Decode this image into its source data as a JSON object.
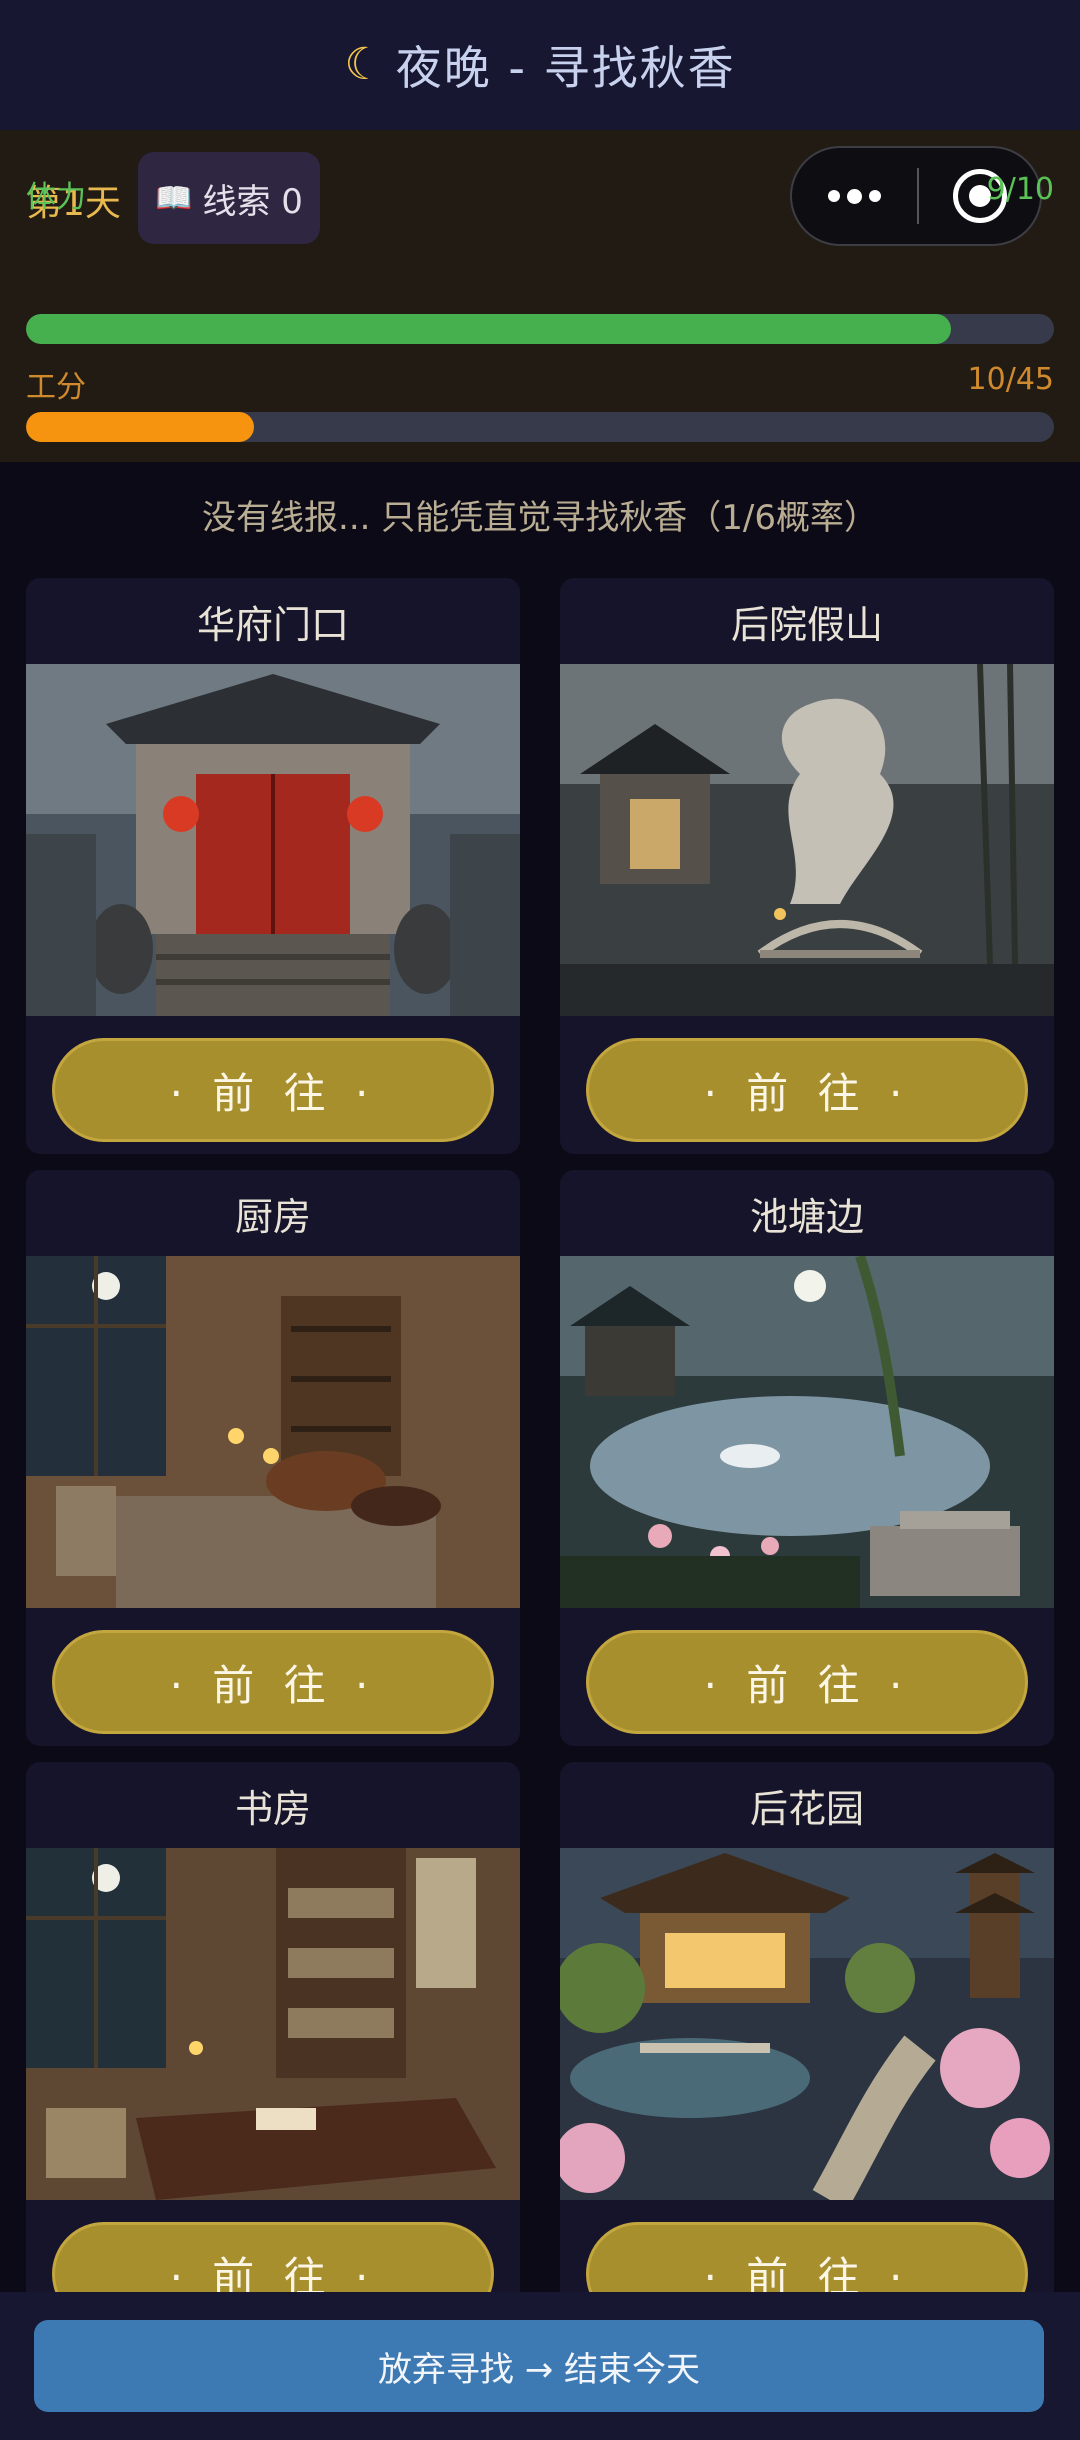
{
  "header": {
    "moon_icon": "crescent-moon-icon",
    "title": "夜晚 - 寻找秋香"
  },
  "status": {
    "day": "第1天",
    "clue_icon": "book-icon",
    "clue_label": "线索 0",
    "stamina": {
      "label": "体力",
      "value_text": "9/10",
      "fraction": 0.9,
      "color": "#46b04e"
    },
    "work": {
      "label": "工分",
      "value_text": "10/45",
      "fraction": 0.222,
      "color": "#f7940f"
    }
  },
  "capsule": {
    "more_icon": "more-dots-icon",
    "close_icon": "target-circle-icon"
  },
  "hint": "没有线报... 只能凭直觉寻找秋香（1/6概率）",
  "locations": [
    {
      "name": "华府门口",
      "button": "· 前 往 ·"
    },
    {
      "name": "后院假山",
      "button": "· 前 往 ·"
    },
    {
      "name": "厨房",
      "button": "· 前 往 ·"
    },
    {
      "name": "池塘边",
      "button": "· 前 往 ·"
    },
    {
      "name": "书房",
      "button": "· 前 往 ·"
    },
    {
      "name": "后花园",
      "button": "· 前 往 ·"
    }
  ],
  "footer": {
    "quit_label": "放弃寻找 → 结束今天"
  }
}
